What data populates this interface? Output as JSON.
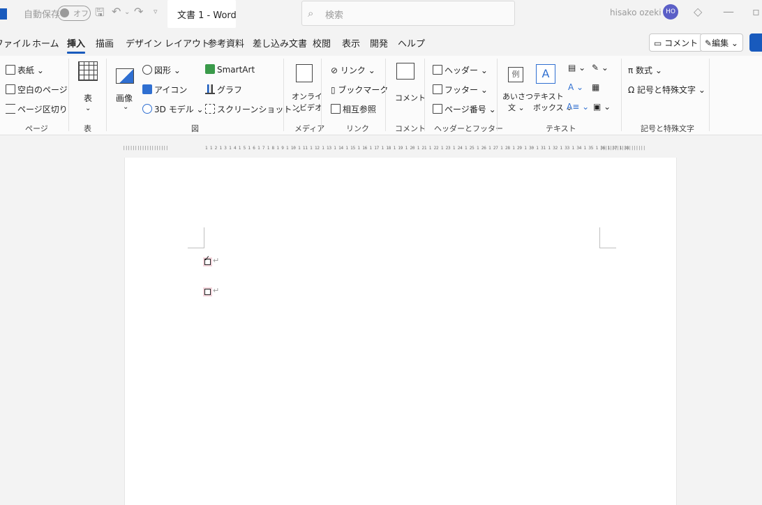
{
  "titlebar": {
    "autosave_label": "自動保存",
    "autosave_state": "オフ",
    "doc_title": "文書 1  -  Word",
    "search_placeholder": "検索",
    "user_name": "hisako ozeki",
    "user_initials": "HO"
  },
  "menu": {
    "tabs": [
      "ファイル",
      "ホーム",
      "挿入",
      "描画",
      "デザイン",
      "レイアウト",
      "参考資料",
      "差し込み文書",
      "校閲",
      "表示",
      "開発",
      "ヘルプ"
    ],
    "active_tab": "挿入",
    "comment_button": "コメント",
    "edit_button": "編集"
  },
  "ribbon": {
    "pages": {
      "cover": "表紙",
      "blank": "空白のページ",
      "break": "ページ区切り",
      "group": "ページ"
    },
    "table": {
      "label": "表",
      "group": "表"
    },
    "illustrations": {
      "image": "画像",
      "shapes": "図形",
      "icons": "アイコン",
      "model3d": "3D モデル",
      "smartart": "SmartArt",
      "chart": "グラフ",
      "screenshot": "スクリーンショット",
      "group": "図"
    },
    "media": {
      "online_video_1": "オンライ",
      "online_video_2": "ンビデオ",
      "group": "メディア"
    },
    "links": {
      "link": "リンク",
      "bookmark": "ブックマーク",
      "crossref": "相互参照",
      "group": "リンク"
    },
    "comments": {
      "comment": "コメント",
      "group": "コメント"
    },
    "header_footer": {
      "header": "ヘッダー",
      "footer": "フッター",
      "page_number": "ページ番号",
      "group": "ヘッダーとフッター"
    },
    "text": {
      "greeting_1": "あいさつ",
      "greeting_2": "文",
      "textbox_1": "テキスト",
      "textbox_2": "ボックス",
      "example": "例",
      "group": "テキスト"
    },
    "symbols": {
      "equation": "数式",
      "symbol": "記号と特殊文字",
      "group": "記号と特殊文字"
    }
  },
  "ruler": {
    "ticks": "1 1 2 1 3 1 4 1 5 1 6 1 7 1 8 1 9 1 10 1 11 1 12 1 13 1 14 1 15 1 16 1 17 1 18 1 19 1 20 1 21 1 22 1 23 1 24 1 25 1 26 1 27 1 28 1 29 1 30 1 31 1 32 1 33 1 34 1 35 1 36 1 37 1 38"
  },
  "document": {
    "checkboxes": [
      {
        "checked": true
      },
      {
        "checked": false
      }
    ],
    "paragraph_mark": "↵"
  }
}
